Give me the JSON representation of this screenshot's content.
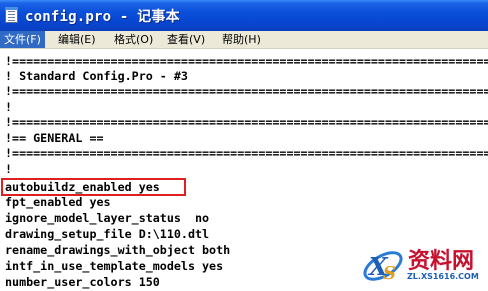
{
  "window": {
    "title": "config.pro - 记事本",
    "icon": "notepad-icon",
    "title_color": "#0a4fd9"
  },
  "menu": [
    {
      "label": "文件(F)",
      "active": true
    },
    {
      "label": "编辑(E)",
      "active": false
    },
    {
      "label": "格式(O)",
      "active": false
    },
    {
      "label": "查看(V)",
      "active": false
    },
    {
      "label": "帮助(H)",
      "active": false
    }
  ],
  "editor": {
    "lines": [
      "!=======================================================================",
      "! Standard Config.Pro - #3",
      "!=======================================================================",
      "!",
      "!=======================================================================",
      "!== GENERAL ==",
      "!=======================================================================",
      "!",
      "autobuildz_enabled yes",
      "fpt_enabled yes",
      "ignore_model_layer_status  no",
      "drawing_setup_file D:\\110.dtl",
      "rename_drawings_with_object both",
      "intf_in_use_template_models yes",
      "number_user_colors 150"
    ],
    "highlighted_line": "autobuildz_enabled yes",
    "highlight_color": "#e02020"
  },
  "watermark": {
    "text": "资料网",
    "url": "ZL.XS1616.COM",
    "logo": "xs-logo-icon"
  }
}
